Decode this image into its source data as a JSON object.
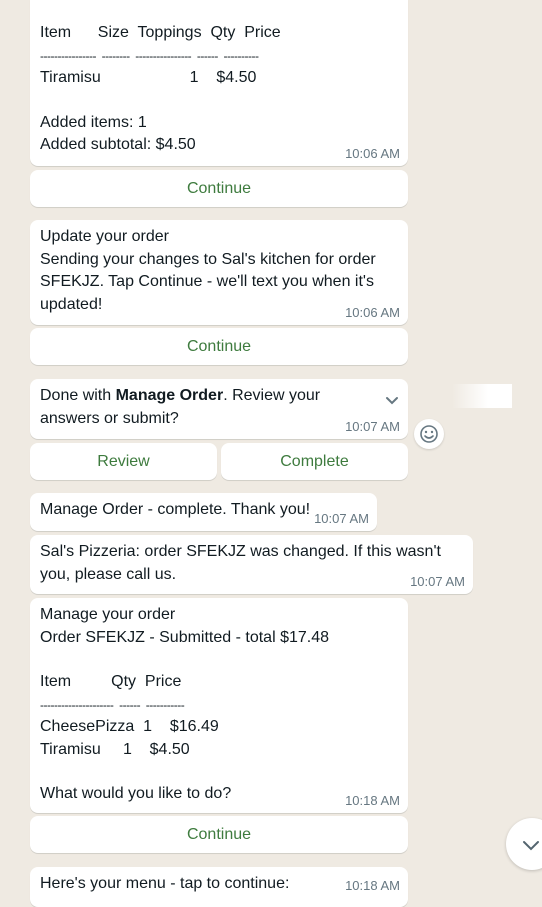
{
  "msg1": {
    "header": "Item      Size  Toppings  Qty  Price",
    "divider": "----------------  --------  ----------------  ------  ----------",
    "row": "Tiramisu                    1    $4.50",
    "added_items": "Added items: 1",
    "added_subtotal": "Added subtotal: $4.50",
    "time": "10:06 AM"
  },
  "btn1": "Continue",
  "msg2": {
    "title": "Update your order",
    "body": "Sending your changes to Sal's kitchen for order SFEKJZ. Tap Continue - we'll text you when it's updated!",
    "time": "10:06 AM"
  },
  "btn2": "Continue",
  "msg3": {
    "prefix": "Done with ",
    "bold": "Manage Order",
    "suffix": ". Review your answers or submit?",
    "time": "10:07 AM"
  },
  "review_btn": "Review",
  "complete_btn": "Complete",
  "msg4": {
    "text": "Manage Order - complete. Thank you!",
    "time": "10:07 AM"
  },
  "msg5": {
    "text": "Sal's Pizzeria: order SFEKJZ was changed. If this wasn't you, please call us.",
    "time": "10:07 AM"
  },
  "msg6": {
    "title": "Manage your order",
    "subtitle": "Order SFEKJZ - Submitted - total $17.48",
    "header": "Item         Qty  Price",
    "divider": "---------------------  ------  -----------",
    "row1": "CheesePizza  1    $16.49",
    "row2": "Tiramisu     1    $4.50",
    "prompt": "What would you like to do?",
    "time": "10:18 AM"
  },
  "btn3": "Continue",
  "msg7": {
    "text": "Here's your menu - tap to continue:",
    "time": "10:18 AM"
  },
  "icons": {
    "emoji": "smiley-icon",
    "chevron": "chevron-down-icon"
  },
  "colors": {
    "background": "#efeae2",
    "accent": "#3e7b3e",
    "timestamp": "#667781"
  }
}
